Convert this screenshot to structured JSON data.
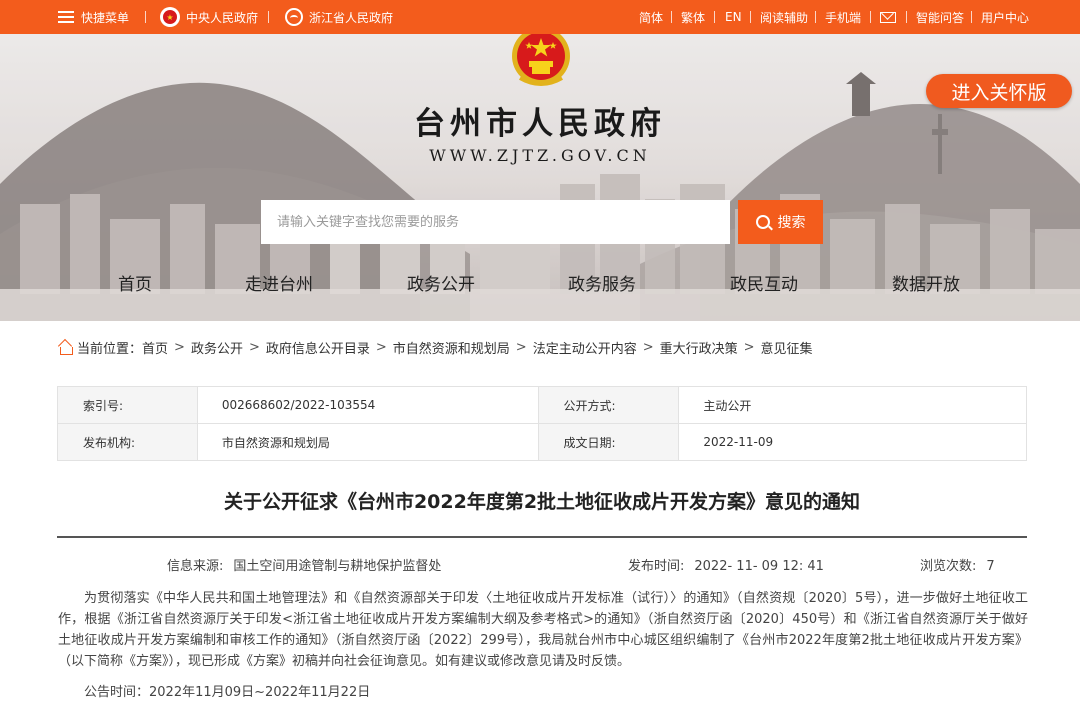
{
  "topbar": {
    "menu_label": "快捷菜单",
    "central_gov": "中央人民政府",
    "province_gov": "浙江省人民政府",
    "right_links": [
      "简体",
      "繁体",
      "EN",
      "阅读辅助",
      "手机端"
    ],
    "qa_label": "智能问答",
    "user_center": "用户中心"
  },
  "header": {
    "title": "台州市人民政府",
    "url": "WWW.ZJTZ.GOV.CN",
    "care_button": "进入关怀版",
    "search_placeholder": "请输入关键字查找您需要的服务",
    "search_button": "搜索"
  },
  "nav": {
    "items": [
      "首页",
      "走进台州",
      "政务公开",
      "政务服务",
      "政民互动",
      "数据开放"
    ]
  },
  "breadcrumb": {
    "label": "当前位置：",
    "items": [
      "首页",
      "政务公开",
      "政府信息公开目录",
      "市自然资源和规划局",
      "法定主动公开内容",
      "重大行政决策",
      "意见征集"
    ]
  },
  "meta": {
    "index_label": "索引号:",
    "index_value": "002668602/2022-103554",
    "method_label": "公开方式:",
    "method_value": "主动公开",
    "publisher_label": "发布机构:",
    "publisher_value": "市自然资源和规划局",
    "date_label": "成文日期:",
    "date_value": "2022-11-09"
  },
  "article": {
    "title": "关于公开征求《台州市2022年度第2批土地征收成片开发方案》意见的通知",
    "source_label": "信息来源:",
    "source_value": "国土空间用途管制与耕地保护监督处",
    "time_label": "发布时间:",
    "time_value": "2022- 11- 09 12: 41",
    "views_label": "浏览次数:",
    "views_value": "7",
    "paragraph": "为贯彻落实《中华人民共和国土地管理法》和《自然资源部关于印发〈土地征收成片开发标准（试行）〉的通知》（自然资规〔2020〕5号），进一步做好土地征收工作，根据《浙江省自然资源厅关于印发<浙江省土地征收成片开发方案编制大纲及参考格式>的通知》（浙自然资厅函〔2020〕450号）和《浙江省自然资源厅关于做好土地征收成片开发方案编制和审核工作的通知》（浙自然资厅函〔2022〕299号），我局就台州市中心城区组织编制了《台州市2022年度第2批土地征收成片开发方案》（以下简称《方案》），现已形成《方案》初稿并向社会征询意见。如有建议或修改意见请及时反馈。",
    "notice_period": "公告时间：2022年11月09日~2022年11月22日"
  },
  "colors": {
    "accent": "#f35c1c",
    "emblem_red": "#d71a1b",
    "emblem_gold": "#f7d21b"
  }
}
